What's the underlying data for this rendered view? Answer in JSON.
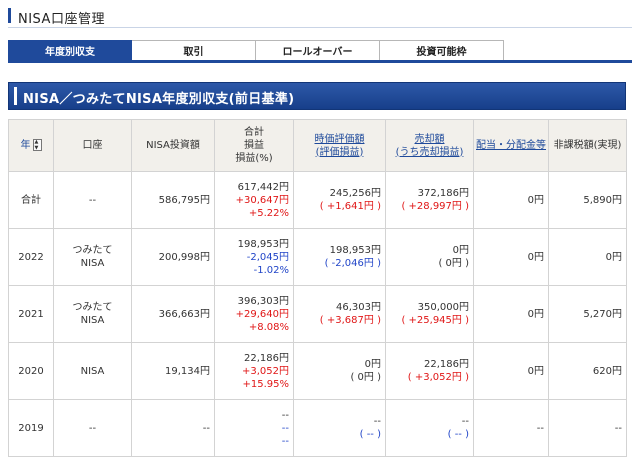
{
  "page": {
    "title": "NISA口座管理"
  },
  "tabs": [
    {
      "label": "年度別収支",
      "active": true
    },
    {
      "label": "取引",
      "active": false
    },
    {
      "label": "ロールオーバー",
      "active": false
    },
    {
      "label": "投資可能枠",
      "active": false
    }
  ],
  "section": {
    "title": "NISA／つみたてNISA年度別収支(前日基準)"
  },
  "table": {
    "headers": {
      "year": "年",
      "account": "口座",
      "investment": "NISA投資額",
      "total_pl_line1": "合計",
      "total_pl_line2": "損益",
      "total_pl_line3": "損益(%)",
      "market_value_line1": "時価評価額",
      "market_value_line2": "(評価損益)",
      "sold_line1": "売却額",
      "sold_line2": "(うち売却損益)",
      "dividends": "配当・分配金等",
      "tax_exempt": "非課税額(実現)"
    },
    "rows": [
      {
        "year": "合計",
        "account1": "--",
        "account2": "",
        "investment": "586,795円",
        "total": "617,442円",
        "pl": "+30,647円",
        "pl_pct": "+5.22%",
        "value": "245,256円",
        "value_pl": "+1,641円",
        "sold": "372,186円",
        "sold_pl": "+28,997円",
        "dividends": "0円",
        "tax_exempt": "5,890円"
      },
      {
        "year": "2022",
        "account1": "つみたて",
        "account2": "NISA",
        "investment": "200,998円",
        "total": "198,953円",
        "pl": "-2,045円",
        "pl_pct": "-1.02%",
        "value": "198,953円",
        "value_pl": "-2,046円",
        "sold": "0円",
        "sold_pl": "0円",
        "dividends": "0円",
        "tax_exempt": "0円"
      },
      {
        "year": "2021",
        "account1": "つみたて",
        "account2": "NISA",
        "investment": "366,663円",
        "total": "396,303円",
        "pl": "+29,640円",
        "pl_pct": "+8.08%",
        "value": "46,303円",
        "value_pl": "+3,687円",
        "sold": "350,000円",
        "sold_pl": "+25,945円",
        "dividends": "0円",
        "tax_exempt": "5,270円"
      },
      {
        "year": "2020",
        "account1": "NISA",
        "account2": "",
        "investment": "19,134円",
        "total": "22,186円",
        "pl": "+3,052円",
        "pl_pct": "+15.95%",
        "value": "0円",
        "value_pl": "0円",
        "sold": "22,186円",
        "sold_pl": "+3,052円",
        "dividends": "0円",
        "tax_exempt": "620円"
      },
      {
        "year": "2019",
        "account1": "--",
        "account2": "",
        "investment": "--",
        "total": "--",
        "pl": "--",
        "pl_pct": "--",
        "value": "--",
        "value_pl": "--",
        "sold": "--",
        "sold_pl": "--",
        "dividends": "--",
        "tax_exempt": "--"
      }
    ]
  },
  "colors": {
    "accent": "#1f4a9b",
    "positive": "#e01616",
    "negative": "#2145c8",
    "header_bg": "#f2f0eb"
  }
}
